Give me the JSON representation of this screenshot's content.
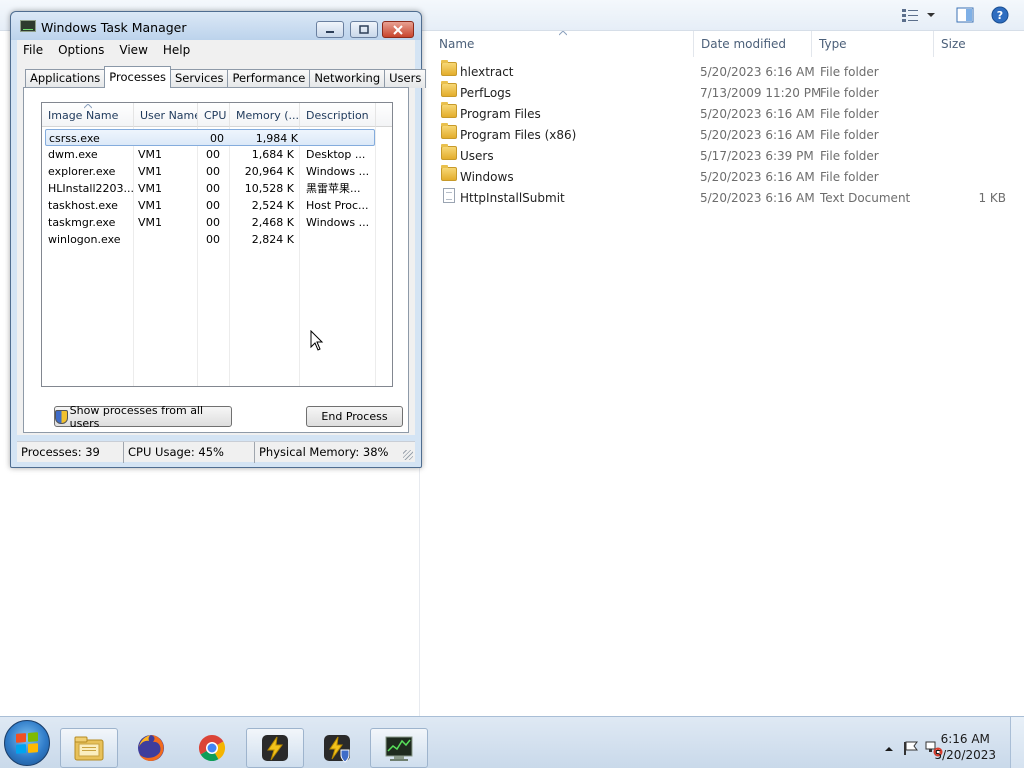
{
  "explorer": {
    "columns": [
      "Name",
      "Date modified",
      "Type",
      "Size"
    ],
    "rows": [
      {
        "icon": "folder-icon",
        "name": "hlextract",
        "date": "5/20/2023 6:16 AM",
        "type": "File folder",
        "size": ""
      },
      {
        "icon": "folder-icon",
        "name": "PerfLogs",
        "date": "7/13/2009 11:20 PM",
        "type": "File folder",
        "size": ""
      },
      {
        "icon": "folder-icon",
        "name": "Program Files",
        "date": "5/20/2023 6:16 AM",
        "type": "File folder",
        "size": ""
      },
      {
        "icon": "folder-icon",
        "name": "Program Files (x86)",
        "date": "5/20/2023 6:16 AM",
        "type": "File folder",
        "size": ""
      },
      {
        "icon": "folder-icon",
        "name": "Users",
        "date": "5/17/2023 6:39 PM",
        "type": "File folder",
        "size": ""
      },
      {
        "icon": "folder-icon",
        "name": "Windows",
        "date": "5/20/2023 6:16 AM",
        "type": "File folder",
        "size": ""
      },
      {
        "icon": "text-document-icon",
        "name": "HttpInstallSubmit",
        "date": "5/20/2023 6:16 AM",
        "type": "Text Document",
        "size": "1 KB"
      }
    ]
  },
  "taskmgr": {
    "title": "Windows Task Manager",
    "menu": [
      "File",
      "Options",
      "View",
      "Help"
    ],
    "tabs": [
      "Applications",
      "Processes",
      "Services",
      "Performance",
      "Networking",
      "Users"
    ],
    "active_tab": "Processes",
    "columns": [
      "Image Name",
      "User Name",
      "CPU",
      "Memory (...",
      "Description"
    ],
    "processes": [
      {
        "image": "csrss.exe",
        "user": "",
        "cpu": "00",
        "memory": "1,984 K",
        "description": ""
      },
      {
        "image": "dwm.exe",
        "user": "VM1",
        "cpu": "00",
        "memory": "1,684 K",
        "description": "Desktop ..."
      },
      {
        "image": "explorer.exe",
        "user": "VM1",
        "cpu": "00",
        "memory": "20,964 K",
        "description": "Windows ..."
      },
      {
        "image": "HLInstall2203...",
        "user": "VM1",
        "cpu": "00",
        "memory": "10,528 K",
        "description": "黑雷苹果..."
      },
      {
        "image": "taskhost.exe",
        "user": "VM1",
        "cpu": "00",
        "memory": "2,524 K",
        "description": "Host Proc..."
      },
      {
        "image": "taskmgr.exe",
        "user": "VM1",
        "cpu": "00",
        "memory": "2,468 K",
        "description": "Windows ..."
      },
      {
        "image": "winlogon.exe",
        "user": "",
        "cpu": "00",
        "memory": "2,824 K",
        "description": ""
      }
    ],
    "show_all_label": "Show processes from all users",
    "end_process_label": "End Process",
    "status": {
      "processes": "Processes: 39",
      "cpu": "CPU Usage: 45%",
      "memory": "Physical Memory: 38%"
    }
  },
  "taskbar": {
    "apps": [
      "windows-explorer-icon",
      "firefox-icon",
      "chrome-icon",
      "installer-icon",
      "installer-shield-icon",
      "task-manager-icon"
    ],
    "clock_time": "6:16 AM",
    "clock_date": "5/20/2023"
  },
  "colors": {
    "selection_border": "#84acdd",
    "taskbar": "#c9d9ea",
    "titlebar": "#bcd3ec"
  }
}
